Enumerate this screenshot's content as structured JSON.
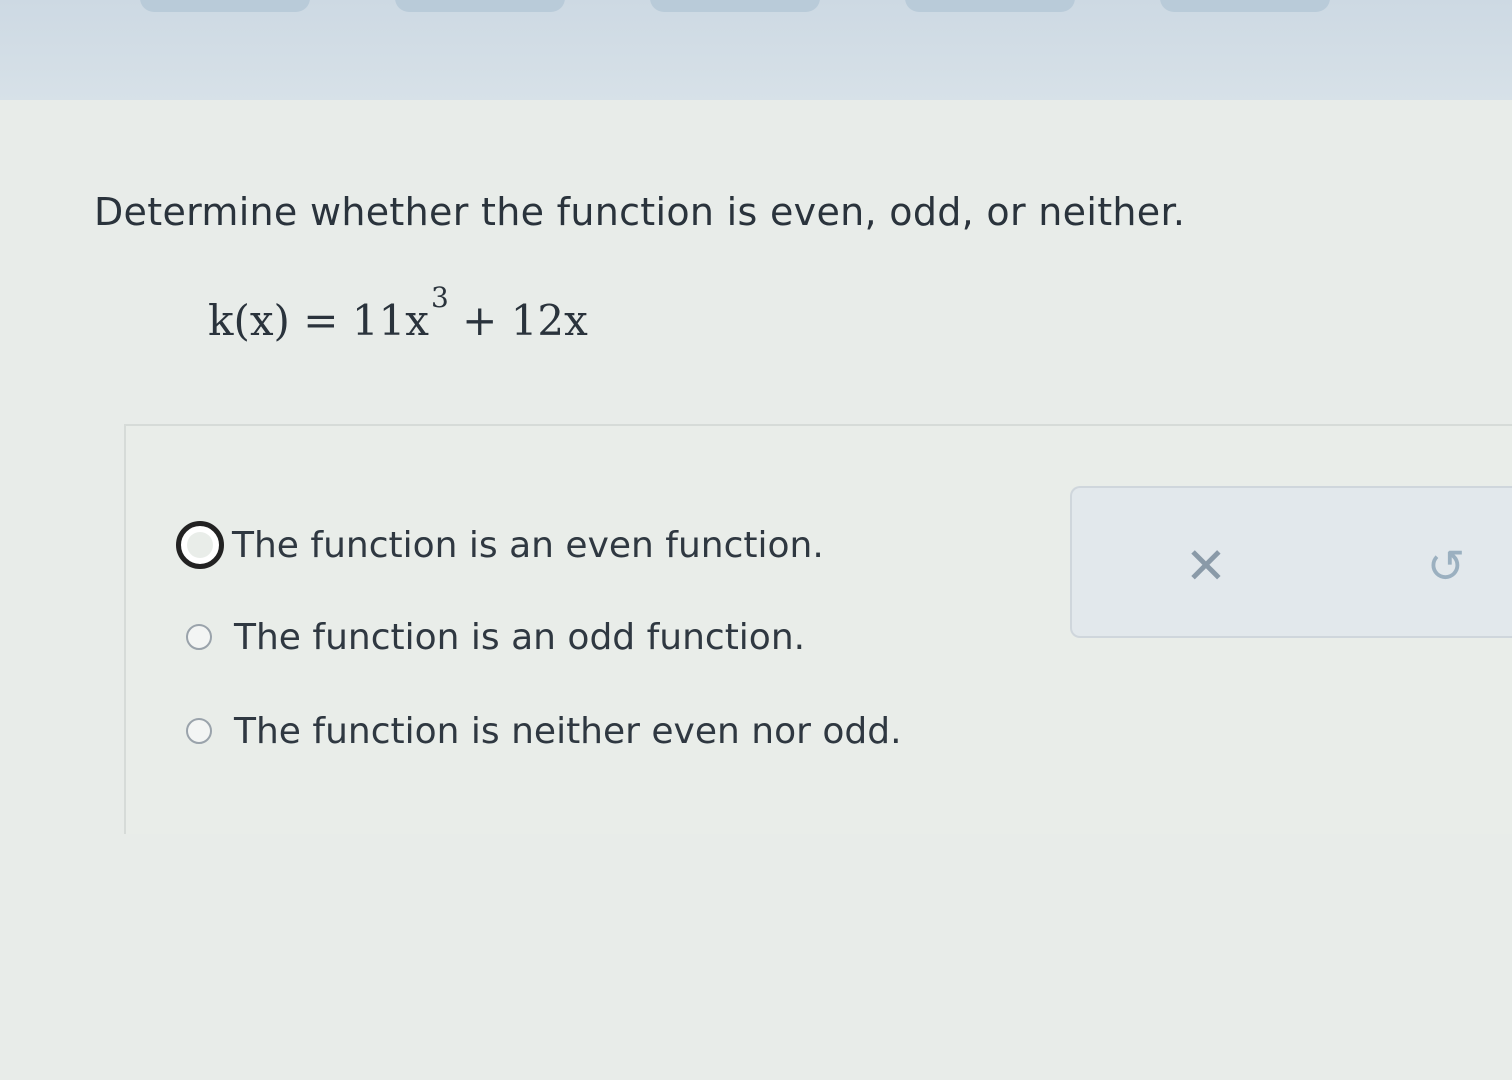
{
  "question": {
    "prompt": "Determine whether the function is even, odd, or neither.",
    "equation_lhs": "k(x)",
    "equation_eq": "=",
    "equation_term1": "11x",
    "equation_exp": "3",
    "equation_rest": "+ 12x"
  },
  "choices": [
    {
      "label": "The function is an even function.",
      "selected": true
    },
    {
      "label": "The function is an odd function.",
      "selected": false
    },
    {
      "label": "The function is neither even nor odd.",
      "selected": false
    }
  ],
  "feedback": {
    "clear_icon": "x-icon",
    "clear_glyph": "✕",
    "undo_icon": "undo-icon",
    "undo_glyph": "↺"
  },
  "colors": {
    "background": "#e8ece9",
    "text": "#2f3a44",
    "feedback_icon": "#8a9aa8"
  }
}
